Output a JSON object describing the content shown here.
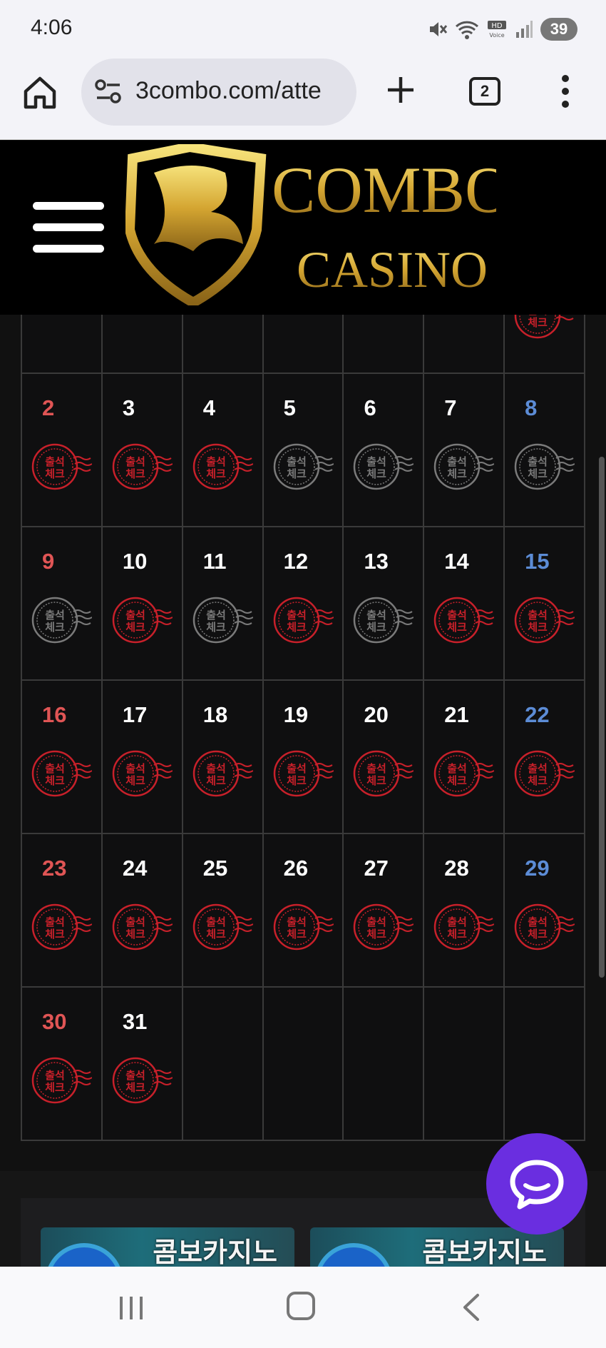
{
  "status_bar": {
    "time": "4:06",
    "battery": "39",
    "hd_voice": "HD Voice"
  },
  "browser": {
    "url": "3combo.com/atte",
    "tab_count": "2"
  },
  "site": {
    "logo_line1": "COMBO",
    "logo_line2": "CASINO"
  },
  "calendar": {
    "first_row_stamp": "checked",
    "weeks": [
      [
        {
          "day": "2",
          "type": "sun",
          "checked": true
        },
        {
          "day": "3",
          "type": "wd",
          "checked": true
        },
        {
          "day": "4",
          "type": "wd",
          "checked": true
        },
        {
          "day": "5",
          "type": "wd",
          "checked": false
        },
        {
          "day": "6",
          "type": "wd",
          "checked": false
        },
        {
          "day": "7",
          "type": "wd",
          "checked": false
        },
        {
          "day": "8",
          "type": "sat",
          "checked": false
        }
      ],
      [
        {
          "day": "9",
          "type": "sun",
          "checked": false
        },
        {
          "day": "10",
          "type": "wd",
          "checked": true
        },
        {
          "day": "11",
          "type": "wd",
          "checked": false
        },
        {
          "day": "12",
          "type": "wd",
          "checked": true
        },
        {
          "day": "13",
          "type": "wd",
          "checked": false
        },
        {
          "day": "14",
          "type": "wd",
          "checked": true
        },
        {
          "day": "15",
          "type": "sat",
          "checked": true
        }
      ],
      [
        {
          "day": "16",
          "type": "sun",
          "checked": true
        },
        {
          "day": "17",
          "type": "wd",
          "checked": true
        },
        {
          "day": "18",
          "type": "wd",
          "checked": true
        },
        {
          "day": "19",
          "type": "wd",
          "checked": true
        },
        {
          "day": "20",
          "type": "wd",
          "checked": true
        },
        {
          "day": "21",
          "type": "wd",
          "checked": true
        },
        {
          "day": "22",
          "type": "sat",
          "checked": true
        }
      ],
      [
        {
          "day": "23",
          "type": "sun",
          "checked": true
        },
        {
          "day": "24",
          "type": "wd",
          "checked": true
        },
        {
          "day": "25",
          "type": "wd",
          "checked": true
        },
        {
          "day": "26",
          "type": "wd",
          "checked": true
        },
        {
          "day": "27",
          "type": "wd",
          "checked": true
        },
        {
          "day": "28",
          "type": "wd",
          "checked": true
        },
        {
          "day": "29",
          "type": "sat",
          "checked": true
        }
      ],
      [
        {
          "day": "30",
          "type": "sun",
          "checked": true
        },
        {
          "day": "31",
          "type": "wd",
          "checked": true
        },
        {
          "day": "",
          "type": "wd",
          "checked": null
        },
        {
          "day": "",
          "type": "wd",
          "checked": null
        },
        {
          "day": "",
          "type": "wd",
          "checked": null
        },
        {
          "day": "",
          "type": "wd",
          "checked": null
        },
        {
          "day": "",
          "type": "wd",
          "checked": null
        }
      ]
    ],
    "stamp_line1": "출석",
    "stamp_line2": "체크"
  },
  "banners": [
    {
      "text": "콤보카지노"
    },
    {
      "text": "콤보카지노"
    }
  ],
  "colors": {
    "stamp_checked": "#c8202a",
    "stamp_unchecked": "#7a7a7a",
    "chat": "#6a2ee0",
    "sun": "#e05555",
    "sat": "#5c8cd6"
  }
}
